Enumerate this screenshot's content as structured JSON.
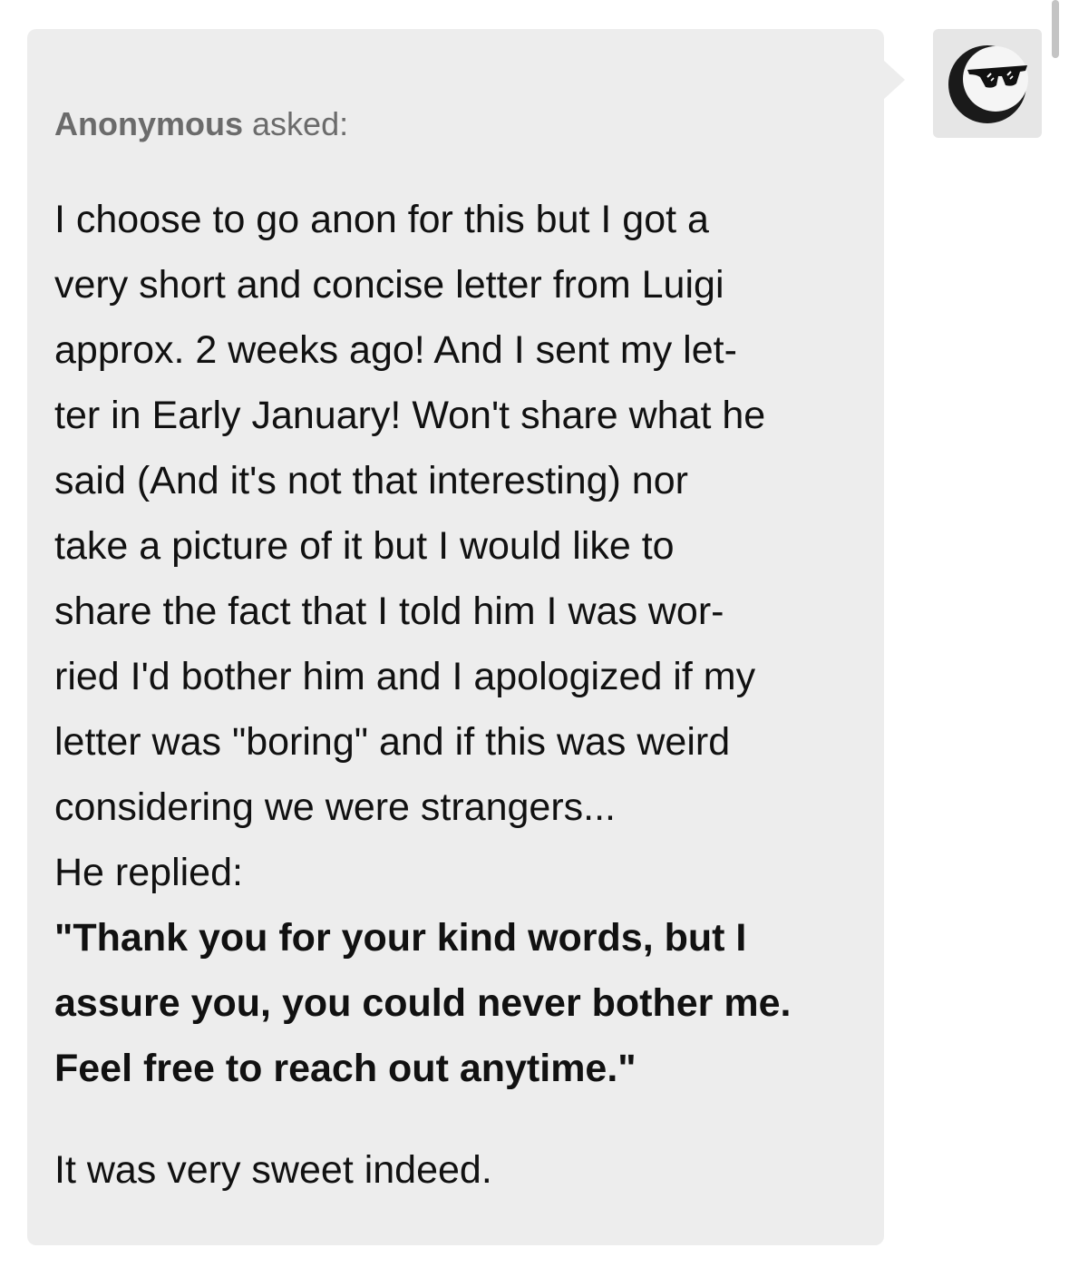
{
  "ask": {
    "asker_name": "Anonymous",
    "asker_verb": "asked:",
    "body_lines": [
      "I choose to go anon for this but I got a",
      "very short and concise letter from Luigi",
      "approx. 2 weeks ago! And I sent my let-",
      "ter in Early January! Won't share what he",
      "said (And it's not that interesting) nor",
      "take a picture of it but I would like to",
      "share the fact that I told him I was wor-",
      "ried I'd bother him and I apologized if my",
      "letter was \"boring\" and if this was weird",
      "considering we were strangers...",
      "He replied:"
    ],
    "quote_lines": [
      "\"Thank you for your kind words, but I",
      "assure you, you could never bother me.",
      "Feel free to reach out anytime.\""
    ],
    "closing": "It was very sweet indeed."
  },
  "avatar": {
    "icon": "sunglasses-crescent-avatar-icon"
  }
}
